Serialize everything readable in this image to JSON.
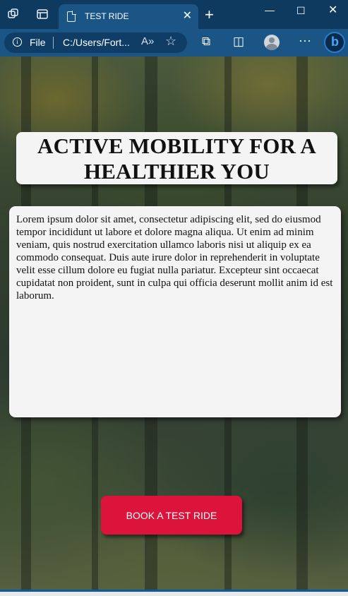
{
  "browser": {
    "tab": {
      "title": "TEST RIDE"
    },
    "address": {
      "scheme_label": "File",
      "url": "C:/Users/Fort..."
    }
  },
  "page": {
    "heading": "ACTIVE MOBILITY FOR A HEALTHIER YOU",
    "body_text": "Lorem ipsum dolor sit amet, consectetur adipiscing elit, sed do eiusmod tempor incididunt ut labore et dolore magna aliqua. Ut enim ad minim veniam, quis nostrud exercitation ullamco laboris nisi ut aliquip ex ea commodo consequat. Duis aute irure dolor in reprehenderit in voluptate velit esse cillum dolore eu fugiat nulla pariatur. Excepteur sint occaecat cupidatat non proident, sunt in culpa qui officia deserunt mollit anim id est laborum.",
    "cta_label": "BOOK A TEST RIDE"
  },
  "colors": {
    "titlebar": "#0e3a5f",
    "toolbar": "#1a5585",
    "cta": "#dc143c",
    "card": "#f4f4f4"
  }
}
